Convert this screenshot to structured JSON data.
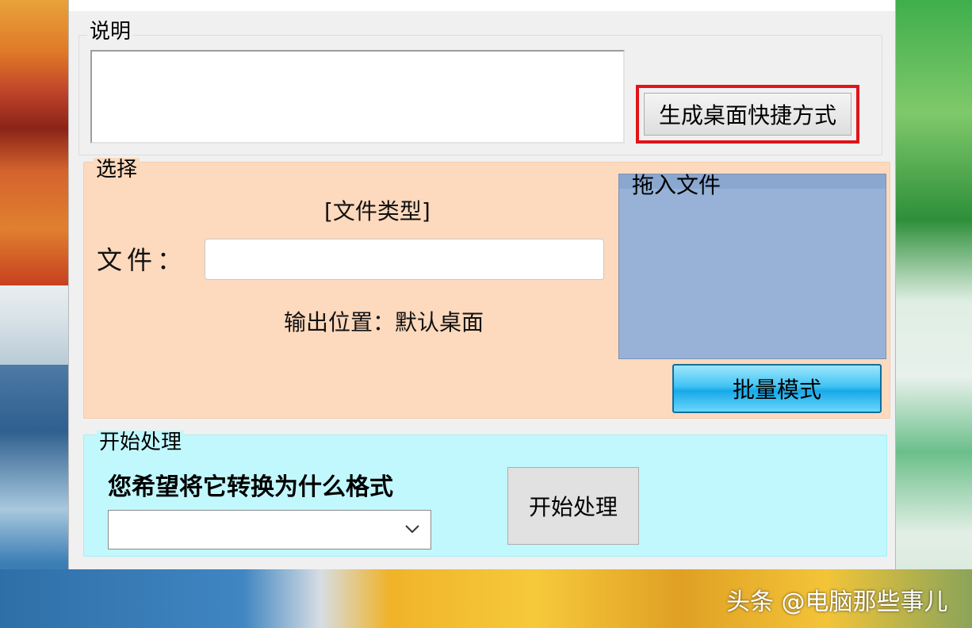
{
  "groups": {
    "description": {
      "title": "说明",
      "text": ""
    },
    "select": {
      "title": "选择",
      "file_type": "[文件类型]",
      "file_label": "文件：",
      "file_value": "",
      "output_location": "输出位置：默认桌面",
      "drop_title": "拖入文件"
    },
    "start": {
      "title": "开始处理",
      "question": "您希望将它转换为什么格式",
      "format_selected": ""
    }
  },
  "buttons": {
    "create_shortcut": "生成桌面快捷方式",
    "batch_mode": "批量模式",
    "start_processing": "开始处理"
  },
  "icons": {
    "dropdown": "chevron-down-icon"
  },
  "colors": {
    "highlight_border": "#e0141b",
    "select_bg": "#fdd9bd",
    "start_bg": "#c1f8fd",
    "drop_bg": "#97b2d6"
  },
  "watermark": "头条 @电脑那些事儿"
}
